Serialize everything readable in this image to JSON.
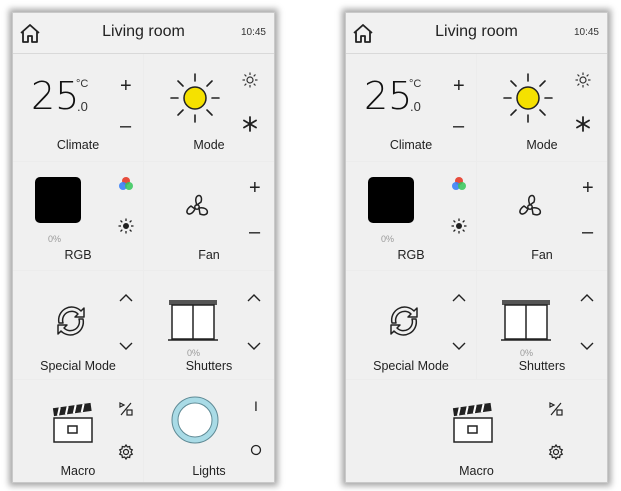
{
  "panels": [
    {
      "header": {
        "title": "Living room",
        "time": "10:45"
      },
      "climate": {
        "temp_int": "25",
        "unit": "°C",
        "temp_dec": ".0",
        "plus": "+",
        "minus": "–",
        "label": "Climate"
      },
      "mode": {
        "label": "Mode"
      },
      "rgb": {
        "percent": "0%",
        "label": "RGB"
      },
      "fan": {
        "plus": "+",
        "minus": "–",
        "label": "Fan"
      },
      "special_mode": {
        "up": "^",
        "down": "v",
        "label": "Special Mode"
      },
      "shutters": {
        "up": "^",
        "down": "v",
        "percent": "0%",
        "label": "Shutters"
      },
      "macro": {
        "label": "Macro"
      },
      "lights": {
        "on": "I",
        "off": "O",
        "label": "Lights"
      }
    },
    {
      "header": {
        "title": "Living room",
        "time": "10:45"
      },
      "climate": {
        "temp_int": "25",
        "unit": "°C",
        "temp_dec": ".0",
        "plus": "+",
        "minus": "–",
        "label": "Climate"
      },
      "mode": {
        "label": "Mode"
      },
      "rgb": {
        "percent": "0%",
        "label": "RGB"
      },
      "fan": {
        "plus": "+",
        "minus": "–",
        "label": "Fan"
      },
      "special_mode": {
        "up": "^",
        "down": "v",
        "label": "Special Mode"
      },
      "shutters": {
        "up": "^",
        "down": "v",
        "percent": "0%",
        "label": "Shutters"
      },
      "macro": {
        "label": "Macro"
      }
    }
  ],
  "colors": {
    "sun": "#f5e100",
    "panel_bg": "#f0f0f0",
    "lights_ring": "#a9dbe6"
  }
}
